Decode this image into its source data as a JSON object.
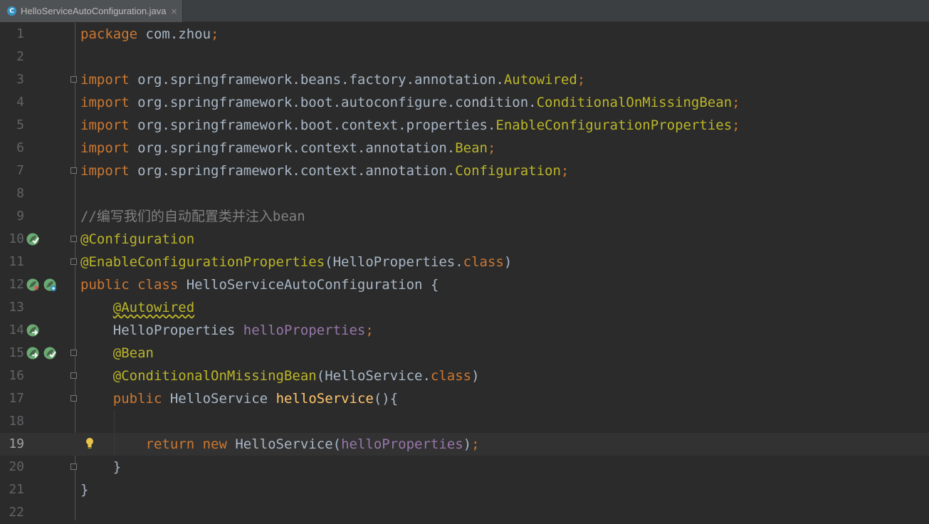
{
  "tab": {
    "icon_letter": "C",
    "title": "HelloServiceAutoConfiguration.java",
    "close_glyph": "×"
  },
  "lines": [
    {
      "num": "1",
      "segs": [
        {
          "t": "package ",
          "c": "kw"
        },
        {
          "t": "com.zhou",
          "c": ""
        },
        {
          "t": ";",
          "c": "kw"
        }
      ]
    },
    {
      "num": "2",
      "segs": []
    },
    {
      "num": "3",
      "segs": [
        {
          "t": "import ",
          "c": "kw"
        },
        {
          "t": "org.springframework.beans.factory.annotation.",
          "c": ""
        },
        {
          "t": "Autowired",
          "c": "cls"
        },
        {
          "t": ";",
          "c": "kw"
        }
      ]
    },
    {
      "num": "4",
      "segs": [
        {
          "t": "import ",
          "c": "kw"
        },
        {
          "t": "org.springframework.boot.autoconfigure.condition.",
          "c": ""
        },
        {
          "t": "ConditionalOnMissingBean",
          "c": "cls"
        },
        {
          "t": ";",
          "c": "kw"
        }
      ]
    },
    {
      "num": "5",
      "segs": [
        {
          "t": "import ",
          "c": "kw"
        },
        {
          "t": "org.springframework.boot.context.properties.",
          "c": ""
        },
        {
          "t": "EnableConfigurationProperties",
          "c": "cls"
        },
        {
          "t": ";",
          "c": "kw"
        }
      ]
    },
    {
      "num": "6",
      "segs": [
        {
          "t": "import ",
          "c": "kw"
        },
        {
          "t": "org.springframework.context.annotation.",
          "c": ""
        },
        {
          "t": "Bean",
          "c": "cls"
        },
        {
          "t": ";",
          "c": "kw"
        }
      ]
    },
    {
      "num": "7",
      "segs": [
        {
          "t": "import ",
          "c": "kw"
        },
        {
          "t": "org.springframework.context.annotation.",
          "c": ""
        },
        {
          "t": "Configuration",
          "c": "cls"
        },
        {
          "t": ";",
          "c": "kw"
        }
      ]
    },
    {
      "num": "8",
      "segs": []
    },
    {
      "num": "9",
      "segs": [
        {
          "t": "//编写我们的自动配置类并注入bean",
          "c": "cmt"
        }
      ]
    },
    {
      "num": "10",
      "segs": [
        {
          "t": "@Configuration",
          "c": "ann"
        }
      ]
    },
    {
      "num": "11",
      "segs": [
        {
          "t": "@EnableConfigurationProperties",
          "c": "ann"
        },
        {
          "t": "(HelloProperties.",
          "c": ""
        },
        {
          "t": "class",
          "c": "kw"
        },
        {
          "t": ")",
          "c": ""
        }
      ]
    },
    {
      "num": "12",
      "segs": [
        {
          "t": "public class ",
          "c": "kw"
        },
        {
          "t": "HelloServiceAutoConfiguration {",
          "c": ""
        }
      ]
    },
    {
      "num": "13",
      "segs": [
        {
          "t": "    ",
          "c": ""
        },
        {
          "t": "@Autowired",
          "c": "ann warn-underline"
        }
      ]
    },
    {
      "num": "14",
      "segs": [
        {
          "t": "    HelloProperties ",
          "c": ""
        },
        {
          "t": "helloProperties",
          "c": "fld"
        },
        {
          "t": ";",
          "c": "kw"
        }
      ]
    },
    {
      "num": "15",
      "segs": [
        {
          "t": "    ",
          "c": ""
        },
        {
          "t": "@Bean",
          "c": "ann"
        }
      ]
    },
    {
      "num": "16",
      "segs": [
        {
          "t": "    ",
          "c": ""
        },
        {
          "t": "@ConditionalOnMissingBean",
          "c": "ann"
        },
        {
          "t": "(HelloService.",
          "c": ""
        },
        {
          "t": "class",
          "c": "kw"
        },
        {
          "t": ")",
          "c": ""
        }
      ]
    },
    {
      "num": "17",
      "segs": [
        {
          "t": "    ",
          "c": ""
        },
        {
          "t": "public ",
          "c": "kw"
        },
        {
          "t": "HelloService ",
          "c": ""
        },
        {
          "t": "helloService",
          "c": "fn"
        },
        {
          "t": "(){",
          "c": ""
        }
      ]
    },
    {
      "num": "18",
      "segs": []
    },
    {
      "num": "19",
      "segs": [
        {
          "t": "        ",
          "c": ""
        },
        {
          "t": "return new ",
          "c": "kw"
        },
        {
          "t": "HelloService(",
          "c": ""
        },
        {
          "t": "helloProperties",
          "c": "fld"
        },
        {
          "t": ")",
          "c": ""
        },
        {
          "t": ";",
          "c": "kw"
        }
      ]
    },
    {
      "num": "20",
      "segs": [
        {
          "t": "    }",
          "c": ""
        }
      ]
    },
    {
      "num": "21",
      "segs": [
        {
          "t": "}",
          "c": ""
        }
      ]
    },
    {
      "num": "22",
      "segs": []
    }
  ],
  "current_line": "19",
  "colors": {
    "background": "#2b2b2b",
    "keyword": "#cc7832",
    "annotation": "#bbb529",
    "field": "#9876aa",
    "method": "#ffc66d",
    "comment": "#808080",
    "text": "#a9b7c6",
    "spring_icon": "#6aab73"
  },
  "gutter_icons": {
    "10": [
      "spring-bean-check-icon"
    ],
    "12": [
      "spring-leaf-icon",
      "spring-bean-navigate-icon"
    ],
    "14": [
      "spring-autowired-icon"
    ],
    "15": [
      "spring-bean-method-icon",
      "spring-bean-check-icon"
    ]
  },
  "fold_markers": [
    "3",
    "7",
    "10",
    "11",
    "15",
    "16",
    "17",
    "20"
  ]
}
